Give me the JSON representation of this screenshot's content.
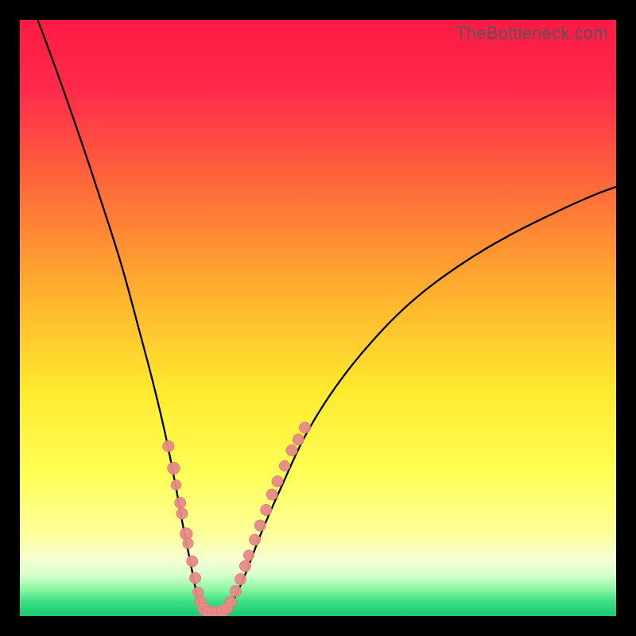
{
  "watermark": {
    "text": "TheBottleneck.com"
  },
  "colors": {
    "gradient_stops": [
      {
        "offset": 0.0,
        "color": "#ff1a45"
      },
      {
        "offset": 0.12,
        "color": "#ff2b4b"
      },
      {
        "offset": 0.28,
        "color": "#ff6a3a"
      },
      {
        "offset": 0.45,
        "color": "#ffae2e"
      },
      {
        "offset": 0.62,
        "color": "#ffe92e"
      },
      {
        "offset": 0.76,
        "color": "#feff55"
      },
      {
        "offset": 0.86,
        "color": "#fdff9a"
      },
      {
        "offset": 0.905,
        "color": "#f6ffd2"
      },
      {
        "offset": 0.93,
        "color": "#d9ffce"
      },
      {
        "offset": 0.955,
        "color": "#8cf7a2"
      },
      {
        "offset": 0.975,
        "color": "#3ddf84"
      },
      {
        "offset": 1.0,
        "color": "#17c96e"
      }
    ],
    "curve_stroke": "#000000",
    "dot_fill": "#e78a88",
    "dot_edge": "#d86a68"
  },
  "chart_data": {
    "type": "line",
    "title": "",
    "xlabel": "",
    "ylabel": "",
    "xlim": [
      0,
      100
    ],
    "ylim": [
      0,
      100
    ],
    "grid": false,
    "series": [
      {
        "name": "bottleneck-curve-left",
        "x": [
          3.0,
          6.5,
          10.0,
          13.5,
          17.0,
          20.0,
          22.5,
          24.5,
          26.0,
          27.2,
          28.2,
          29.0,
          29.6,
          30.2,
          30.8
        ],
        "y": [
          100,
          90.5,
          80.5,
          70.0,
          59.0,
          48.0,
          38.5,
          30.0,
          22.5,
          16.0,
          11.0,
          7.0,
          4.0,
          2.0,
          0.8
        ]
      },
      {
        "name": "valley-floor",
        "x": [
          30.8,
          31.6,
          32.6,
          33.6,
          34.6
        ],
        "y": [
          0.8,
          0.5,
          0.5,
          0.6,
          0.9
        ]
      },
      {
        "name": "bottleneck-curve-right",
        "x": [
          34.6,
          36.0,
          38.0,
          40.5,
          44.0,
          48.0,
          53.0,
          59.0,
          66.0,
          74.0,
          82.0,
          90.0,
          96.0,
          100.0
        ],
        "y": [
          0.9,
          3.0,
          7.5,
          14.0,
          22.0,
          30.5,
          38.5,
          46.0,
          53.0,
          59.0,
          63.8,
          67.8,
          70.5,
          72.0
        ]
      }
    ],
    "scatter": {
      "name": "sample-dots",
      "points": [
        {
          "x": 24.9,
          "y": 28.5,
          "r": 1.0
        },
        {
          "x": 25.8,
          "y": 24.8,
          "r": 1.1
        },
        {
          "x": 26.2,
          "y": 22.0,
          "r": 0.9
        },
        {
          "x": 26.9,
          "y": 19.0,
          "r": 1.0
        },
        {
          "x": 27.2,
          "y": 17.2,
          "r": 1.0
        },
        {
          "x": 27.9,
          "y": 13.8,
          "r": 1.1
        },
        {
          "x": 28.2,
          "y": 12.2,
          "r": 0.95
        },
        {
          "x": 28.9,
          "y": 9.2,
          "r": 1.0
        },
        {
          "x": 29.4,
          "y": 6.4,
          "r": 1.0
        },
        {
          "x": 29.9,
          "y": 4.0,
          "r": 0.95
        },
        {
          "x": 30.3,
          "y": 2.4,
          "r": 1.0
        },
        {
          "x": 30.9,
          "y": 1.2,
          "r": 1.1
        },
        {
          "x": 31.6,
          "y": 0.6,
          "r": 1.1
        },
        {
          "x": 32.4,
          "y": 0.55,
          "r": 1.1
        },
        {
          "x": 33.2,
          "y": 0.6,
          "r": 1.1
        },
        {
          "x": 34.0,
          "y": 0.8,
          "r": 1.1
        },
        {
          "x": 34.8,
          "y": 1.4,
          "r": 1.05
        },
        {
          "x": 35.4,
          "y": 2.4,
          "r": 1.0
        },
        {
          "x": 36.2,
          "y": 4.2,
          "r": 1.0
        },
        {
          "x": 37.0,
          "y": 6.2,
          "r": 1.0
        },
        {
          "x": 37.8,
          "y": 8.4,
          "r": 1.0
        },
        {
          "x": 38.4,
          "y": 10.2,
          "r": 0.95
        },
        {
          "x": 39.4,
          "y": 12.8,
          "r": 1.0
        },
        {
          "x": 40.3,
          "y": 15.2,
          "r": 1.0
        },
        {
          "x": 41.3,
          "y": 17.8,
          "r": 1.0
        },
        {
          "x": 42.3,
          "y": 20.4,
          "r": 1.0
        },
        {
          "x": 43.2,
          "y": 22.6,
          "r": 1.0
        },
        {
          "x": 44.4,
          "y": 25.2,
          "r": 0.95
        },
        {
          "x": 45.6,
          "y": 27.8,
          "r": 1.0
        },
        {
          "x": 46.7,
          "y": 29.6,
          "r": 1.0
        },
        {
          "x": 47.8,
          "y": 31.6,
          "r": 1.0
        }
      ]
    }
  }
}
